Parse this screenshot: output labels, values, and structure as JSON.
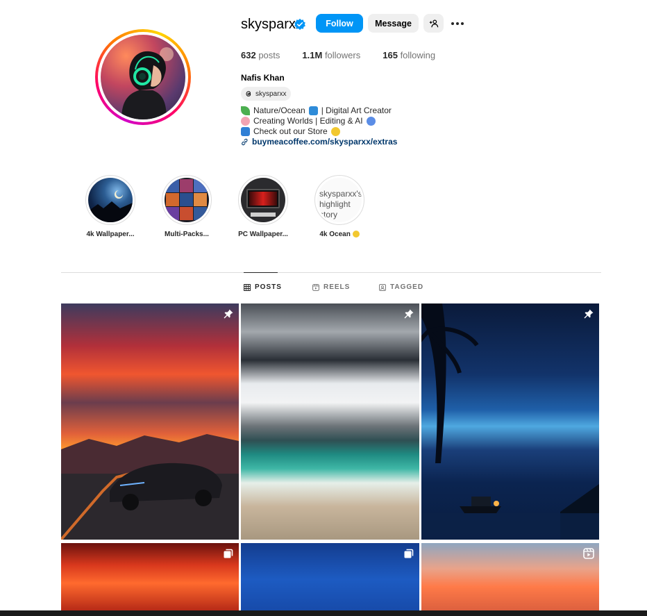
{
  "profile": {
    "username": "skysparxx",
    "follow_label": "Follow",
    "message_label": "Message",
    "posts_count": "632",
    "posts_label": "posts",
    "followers_count": "1.1M",
    "followers_label": "followers",
    "following_count": "165",
    "following_label": "following",
    "full_name": "Nafis Khan",
    "threads_handle": "skysparxx",
    "bio": [
      "Nature/Ocean",
      "| Digital Art Creator",
      "Creating Worlds | Editing & AI",
      "Check out our Store"
    ],
    "link": "buymeacoffee.com/skysparxx/extras"
  },
  "highlights": [
    {
      "label": "4k Wallpaper..."
    },
    {
      "label": "Multi-Packs..."
    },
    {
      "label": "PC Wallpaper..."
    },
    {
      "label": "4k Ocean",
      "broken_alt": "skysparxx's highlight story"
    }
  ],
  "tabs": {
    "posts": "POSTS",
    "reels": "REELS",
    "tagged": "TAGGED",
    "active": "posts"
  },
  "colors": {
    "accent": "#0095f6",
    "button_bg": "#efefef",
    "link": "#00376b",
    "muted": "#737373"
  },
  "icons": {
    "verified": "verified-badge-icon",
    "add_user": "add-user-icon",
    "more": "more-options-icon",
    "threads": "threads-icon",
    "link": "link-icon",
    "pinned": "pin-icon",
    "carousel": "carousel-icon",
    "reel": "reel-icon"
  }
}
